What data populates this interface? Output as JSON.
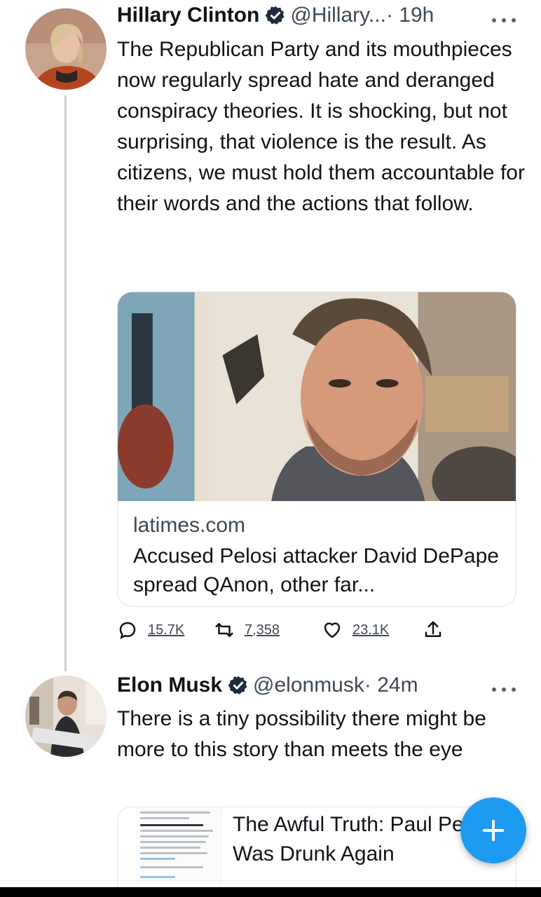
{
  "tweet1": {
    "name": "Hillary Clinton",
    "handle": "@Hillary...",
    "time": "· 19h",
    "text": "The Republican Party and its mouthpieces now regularly spread hate and deranged conspiracy theories. It is shocking, but not surprising, that violence is the result. As citizens, we must hold them accountable for their words and the actions that follow.",
    "card": {
      "domain": "latimes.com",
      "title": "Accused Pelosi attacker David DePape spread QAnon, other far..."
    },
    "actions": {
      "replies": "15.7K",
      "retweets": "7,358",
      "likes": "23.1K"
    }
  },
  "tweet2": {
    "name": "Elon Musk",
    "handle": "@elonmusk",
    "time": "· 24m",
    "text": "There is a tiny possibility there might be more to this story than meets the eye",
    "quote": {
      "title": "The Awful Truth: Paul Pelosi Was Drunk Again"
    }
  },
  "icons": {
    "verified": "verified-badge-icon",
    "more": "more-dots-icon",
    "reply": "reply-icon",
    "retweet": "retweet-icon",
    "like": "heart-icon",
    "share": "share-icon",
    "compose": "plus-icon"
  },
  "colors": {
    "accent": "#1d9bf0",
    "text": "#0f1419",
    "secondary": "#3e4a55",
    "border": "#dfe5ea"
  }
}
